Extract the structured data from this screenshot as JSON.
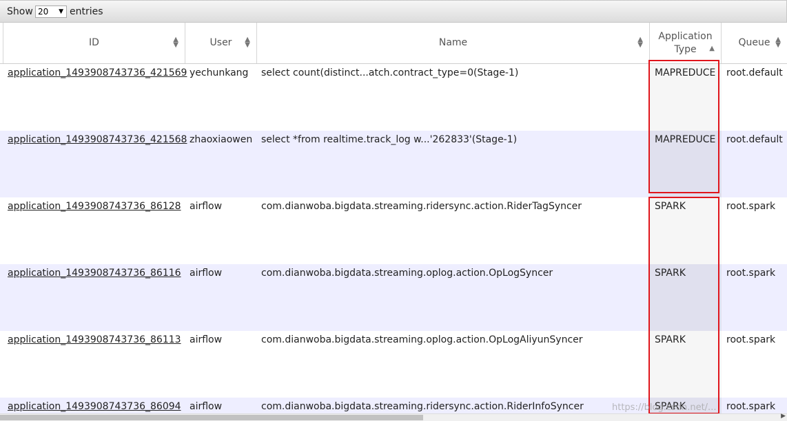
{
  "toolbar": {
    "show_label": "Show",
    "page_size": "20",
    "entries_label": "entries"
  },
  "columns": [
    {
      "label": "ID",
      "sort": "both"
    },
    {
      "label": "User",
      "sort": "both"
    },
    {
      "label": "Name",
      "sort": "both"
    },
    {
      "label": "Application Type",
      "sort": "asc"
    },
    {
      "label": "Queue",
      "sort": "both"
    }
  ],
  "rows": [
    {
      "id": "application_1493908743736_421569",
      "user": "yechunkang",
      "name": "select count(distinct...atch.contract_type=0(Stage-1)",
      "type": "MAPREDUCE",
      "queue": "root.default"
    },
    {
      "id": "application_1493908743736_421568",
      "user": "zhaoxiaowen",
      "name": "select *from realtime.track_log w...'262833'(Stage-1)",
      "type": "MAPREDUCE",
      "queue": "root.default"
    },
    {
      "id": "application_1493908743736_86128",
      "user": "airflow",
      "name": "com.dianwoba.bigdata.streaming.ridersync.action.RiderTagSyncer",
      "type": "SPARK",
      "queue": "root.spark"
    },
    {
      "id": "application_1493908743736_86116",
      "user": "airflow",
      "name": "com.dianwoba.bigdata.streaming.oplog.action.OpLogSyncer",
      "type": "SPARK",
      "queue": "root.spark"
    },
    {
      "id": "application_1493908743736_86113",
      "user": "airflow",
      "name": "com.dianwoba.bigdata.streaming.oplog.action.OpLogAliyunSyncer",
      "type": "SPARK",
      "queue": "root.spark"
    },
    {
      "id": "application_1493908743736_86094",
      "user": "airflow",
      "name": "com.dianwoba.bigdata.streaming.ridersync.action.RiderInfoSyncer",
      "type": "SPARK",
      "queue": "root.spark"
    }
  ],
  "watermark": "https://blog.csdn.net/...",
  "colors": {
    "highlight_border": "#e0141b",
    "even_row": "#eeeeff"
  }
}
